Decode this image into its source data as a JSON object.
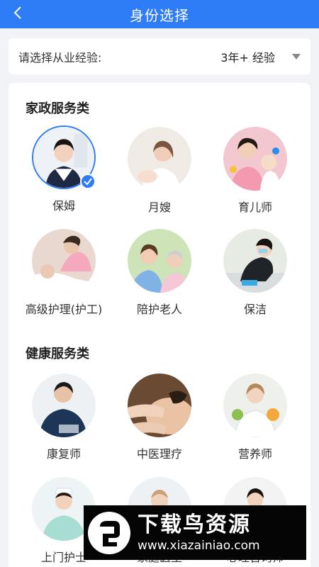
{
  "header": {
    "title": "身份选择",
    "background_color": "#2f7df6"
  },
  "experience": {
    "label": "请选择从业经验:",
    "value": "3年+ 经验"
  },
  "sections": [
    {
      "title": "家政服务类",
      "items": [
        {
          "label": "保姆",
          "selected": true
        },
        {
          "label": "月嫂"
        },
        {
          "label": "育儿师"
        },
        {
          "label": "高级护理(护工)"
        },
        {
          "label": "陪护老人"
        },
        {
          "label": "保洁"
        }
      ]
    },
    {
      "title": "健康服务类",
      "items": [
        {
          "label": "康复师"
        },
        {
          "label": "中医理疗"
        },
        {
          "label": "营养师"
        },
        {
          "label": "上门护士"
        },
        {
          "label": "家庭医生"
        },
        {
          "label": "心理咨询师"
        }
      ]
    }
  ],
  "watermark": {
    "title": "下载鸟资源",
    "url": "www.xiazainiao.com"
  }
}
